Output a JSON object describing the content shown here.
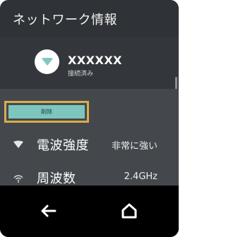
{
  "page": {
    "title": "ネットワーク情報"
  },
  "network": {
    "ssid": "XXXXXX",
    "status": "接続済み",
    "icon": "wifi-icon"
  },
  "actions": {
    "delete_label": "削除"
  },
  "details": [
    {
      "label": "電波強度",
      "value": "非常に強い",
      "icon": "signal-strength-icon"
    },
    {
      "label": "周波数",
      "value": "2.4GHz",
      "icon": "wifi-frequency-icon"
    }
  ],
  "navigation": {
    "back_icon": "back-arrow-icon",
    "home_icon": "home-icon"
  },
  "colors": {
    "header_background": "#2f3237",
    "network_background": "#33373c",
    "list_background": "#44484d",
    "focus_color": "#d8ad4c",
    "delete_button": "#7cc6be",
    "navigation_background": "#000000"
  }
}
